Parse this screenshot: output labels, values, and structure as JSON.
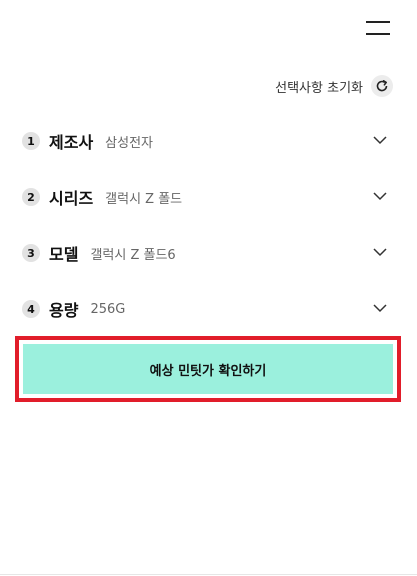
{
  "header": {
    "menu_icon": "hamburger-menu-icon"
  },
  "reset": {
    "label": "선택사항 초기화",
    "icon": "refresh-icon"
  },
  "steps": [
    {
      "number": "1",
      "title": "제조사",
      "value": "삼성전자"
    },
    {
      "number": "2",
      "title": "시리즈",
      "value": "갤럭시 Z 폴드"
    },
    {
      "number": "3",
      "title": "모델",
      "value": "갤럭시 Z 폴드6"
    },
    {
      "number": "4",
      "title": "용량",
      "value": "256G"
    }
  ],
  "cta": {
    "label": "예상 민팃가 확인하기",
    "background": "#9bf0dd",
    "highlight_border": "#e11d2a"
  }
}
